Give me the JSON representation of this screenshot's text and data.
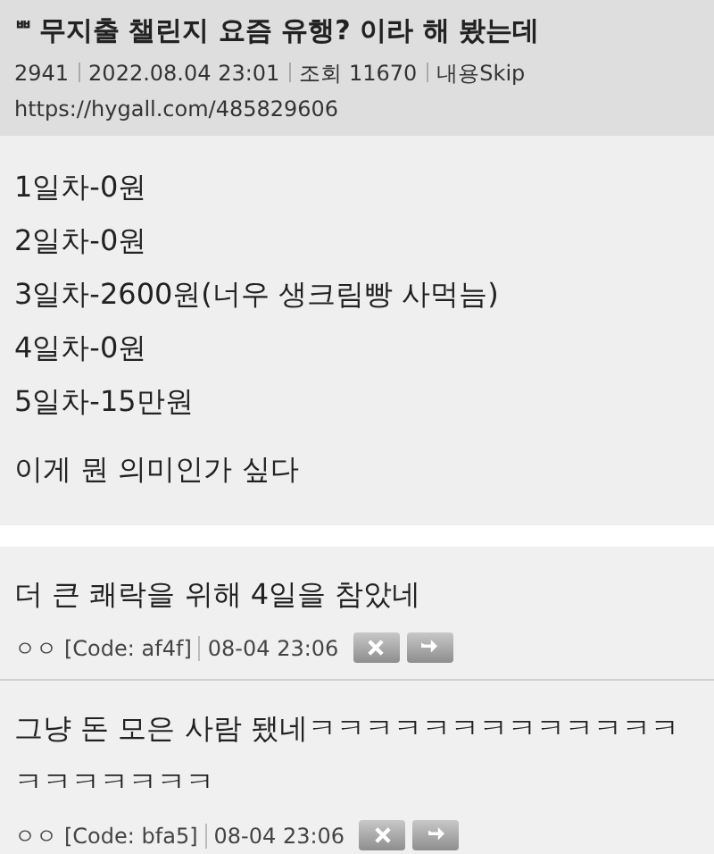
{
  "post": {
    "badge": "ᄈ",
    "title": "무지출 챌린지 요즘 유행? 이라 해 봤는데",
    "meta": [
      "2941",
      "2022.08.04 23:01",
      "조회 11670",
      "내용Skip"
    ],
    "url": "https://hygall.com/485829606",
    "body": [
      "1일차-0원",
      "2일차-0원",
      "3일차-2600원(너우 생크림빵 사먹늠)",
      "4일차-0원",
      "5일차-15만원"
    ],
    "closing": "이게 뭔 의미인가 싶다"
  },
  "comments": [
    {
      "text": "더 큰 쾌락을 위해 4일을 참았네",
      "author": "ㅇㅇ",
      "code": "[Code: af4f]",
      "time": "08-04 23:06"
    },
    {
      "text": "그냥 돈 모은 사람 됐네ㅋㅋㅋㅋㅋㅋㅋㅋㅋㅋㅋㅋㅋㅋㅋㅋㅋㅋㅋㅋ",
      "author": "ㅇㅇ",
      "code": "[Code: bfa5]",
      "time": "08-04 23:06"
    }
  ]
}
